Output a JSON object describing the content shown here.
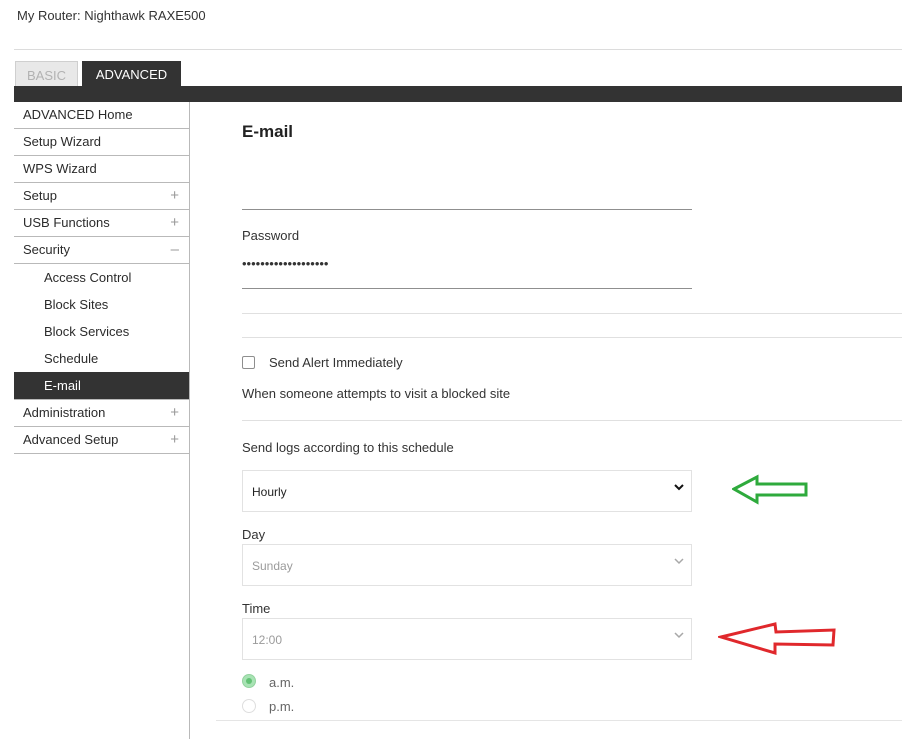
{
  "header": {
    "router_label": "My Router:",
    "router_name": "Nighthawk RAXE500"
  },
  "tabs": [
    {
      "label": "BASIC",
      "active": false
    },
    {
      "label": "ADVANCED",
      "active": true
    }
  ],
  "sidebar": {
    "items": [
      {
        "label": "ADVANCED Home"
      },
      {
        "label": "Setup Wizard"
      },
      {
        "label": "WPS Wizard"
      },
      {
        "label": "Setup",
        "toggle": "+"
      },
      {
        "label": "USB Functions",
        "toggle": "+"
      },
      {
        "label": "Security",
        "toggle": "–"
      },
      {
        "label": "Administration",
        "toggle": "+"
      },
      {
        "label": "Advanced Setup",
        "toggle": "+"
      }
    ],
    "security_sub": [
      {
        "label": "Access Control"
      },
      {
        "label": "Block Sites"
      },
      {
        "label": "Block Services"
      },
      {
        "label": "Schedule"
      },
      {
        "label": "E-mail",
        "active": true
      }
    ]
  },
  "main": {
    "title": "E-mail",
    "password": {
      "label": "Password",
      "value": "•••••••••••••••••••"
    },
    "send_alert": {
      "label": "Send Alert Immediately",
      "checked": false
    },
    "blocked_note": "When someone attempts to visit a blocked site",
    "schedule_label": "Send logs according to this schedule",
    "frequency": {
      "value": "Hourly"
    },
    "day": {
      "label": "Day",
      "value": "Sunday"
    },
    "time": {
      "label": "Time",
      "value": "12:00"
    },
    "ampm": [
      {
        "label": "a.m.",
        "selected": true
      },
      {
        "label": "p.m.",
        "selected": false
      }
    ]
  },
  "annotations": {
    "green_arrow_color": "#2eaa3c",
    "red_arrow_color": "#e0282c"
  },
  "icons": {
    "select_chevron": "chevron-down-icon",
    "green_arrow": "arrow-left-icon",
    "red_arrow": "arrow-left-icon"
  }
}
